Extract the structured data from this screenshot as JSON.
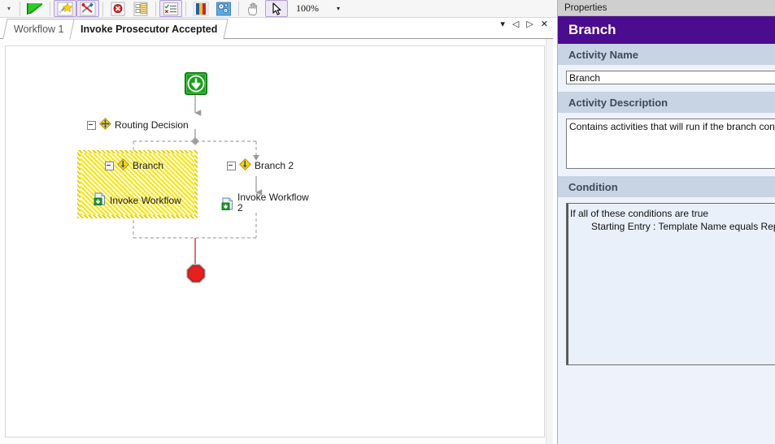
{
  "toolbar": {
    "overflow_caret": "▾",
    "zoom_value": "100%",
    "zoom_caret": "▾",
    "buttons": [
      {
        "name": "run-workflow-button",
        "icon": "green-play-flag-icon",
        "highlighted": false
      },
      {
        "name": "new-activity-button",
        "icon": "wand-star-icon",
        "highlighted": true
      },
      {
        "name": "edit-activity-button",
        "icon": "wand-tools-icon",
        "highlighted": true
      },
      {
        "name": "delete-activity-button",
        "icon": "document-delete-icon",
        "highlighted": false
      },
      {
        "name": "properties-button",
        "icon": "document-properties-icon",
        "highlighted": false
      },
      {
        "name": "validate-workflow-button",
        "icon": "checklist-validate-icon",
        "highlighted": true
      },
      {
        "name": "color-legend-button",
        "icon": "color-bars-icon",
        "highlighted": false
      },
      {
        "name": "workflow-settings-button",
        "icon": "blue-gears-icon",
        "highlighted": false
      },
      {
        "name": "pan-tool-button",
        "icon": "hand-pan-icon",
        "highlighted": false
      },
      {
        "name": "select-tool-button",
        "icon": "arrow-select-icon",
        "highlighted": true
      }
    ]
  },
  "tabs": {
    "inactive_label": "Workflow 1",
    "active_label": "Invoke Prosecutor Accepted",
    "controls": {
      "dropdown": "▾",
      "prev": "◁",
      "next": "▷",
      "close": "✕"
    }
  },
  "canvas": {
    "nodes": {
      "start": {
        "label": "",
        "icon": "green-start-down-arrow-icon"
      },
      "routing_decision": {
        "label": "Routing Decision",
        "icon": "yellow-diamond-routing-icon",
        "expander": "collapse"
      },
      "branch": {
        "label": "Branch",
        "icon": "yellow-diamond-branch-icon",
        "expander": "collapse",
        "selected": true
      },
      "branch_2": {
        "label": "Branch 2",
        "icon": "yellow-diamond-branch-icon",
        "expander": "collapse",
        "selected": false
      },
      "invoke_workflow": {
        "label": "Invoke Workflow",
        "icon": "invoke-workflow-document-icon"
      },
      "invoke_workflow_2_line1": "Invoke Workflow",
      "invoke_workflow_2_line2": "2",
      "invoke_workflow_2_icon": "invoke-workflow-document-icon",
      "stop": {
        "label": "",
        "icon": "red-octagon-stop-icon"
      }
    }
  },
  "properties": {
    "panel_title": "Properties",
    "header_title": "Branch",
    "header_color": "#4b0c8f",
    "sections": {
      "activity_name": {
        "heading": "Activity Name",
        "value": "Branch"
      },
      "activity_description": {
        "heading": "Activity Description",
        "value": "Contains activities that will run if the branch conditions"
      },
      "condition": {
        "heading": "Condition",
        "line_1": "If all of these conditions are true",
        "line_2": "Starting Entry : Template Name equals Report"
      }
    }
  }
}
